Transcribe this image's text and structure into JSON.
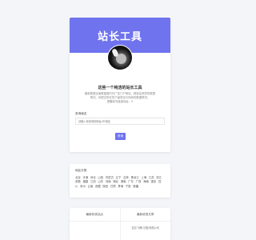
{
  "banner": {
    "title": "站长工具"
  },
  "intro": {
    "slogan": "这些一个纯洁的站长工具",
    "description": "最新数据全面覆盖国内外广告门户网站，精准反馈您的数据情况。你提交所在的下级项目与你网的数据情况。",
    "note": "提醒填写链接地址：0"
  },
  "form": {
    "label": "查询域名",
    "placeholder": "请输入待查询的网址/IP/域名"
  },
  "query_button": "查询",
  "areas": {
    "title": "地区分类",
    "items": [
      "北京",
      "天津",
      "河北",
      "山西",
      "内蒙古",
      "辽宁",
      "吉林",
      "黑龙江",
      "上海",
      "江苏",
      "浙江",
      "安徽",
      "福建",
      "江西",
      "山东",
      "河南",
      "湖北",
      "湖南",
      "广东",
      "广西",
      "海南",
      "重庆",
      "四川",
      "贵州",
      "云南",
      "西藏",
      "陕西",
      "甘肃",
      "青海",
      "宁夏",
      "新疆"
    ]
  },
  "bottom": {
    "left_title": "最新收录站点",
    "right_title": "最新收录文章",
    "right_item": "如意飞腾(中国)有限公司"
  }
}
